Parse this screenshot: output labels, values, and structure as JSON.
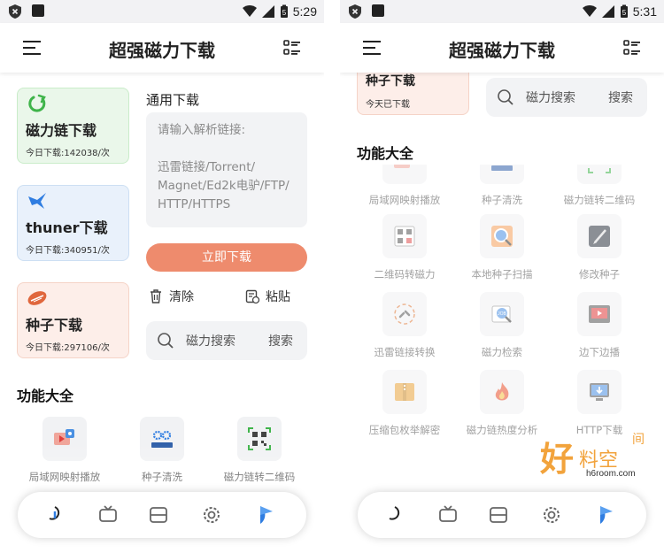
{
  "left": {
    "status": {
      "time": "5:29"
    },
    "appbar": {
      "title": "超强磁力下载"
    },
    "cards": [
      {
        "title": "磁力链下载",
        "sub": "今日下载:142038/次",
        "bg": "#eaf7ea",
        "border": "#c9ecc9"
      },
      {
        "title": "thuner下载",
        "sub": "今日下载:340951/次",
        "bg": "#e9f1fb",
        "border": "#cddff3"
      },
      {
        "title": "种子下载",
        "sub": "今日下载:297106/次",
        "bg": "#fdeee9",
        "border": "#f5d3c7"
      }
    ],
    "general": {
      "title": "通用下载",
      "placeholder_1": "请输入解析链接:",
      "placeholder_2": "迅雷链接/Torrent/",
      "placeholder_3": "Magnet/Ed2k电驴/FTP/",
      "placeholder_4": "HTTP/HTTPS",
      "download_button": "立即下载",
      "clear_label": "清除",
      "paste_label": "粘贴"
    },
    "search": {
      "placeholder": "磁力搜索",
      "button": "搜索"
    },
    "functions": {
      "title": "功能大全",
      "tools": [
        {
          "label": "局域网映射播放",
          "icon": "video-cast-icon"
        },
        {
          "label": "种子清洗",
          "icon": "gears-icon"
        },
        {
          "label": "磁力链转二维码",
          "icon": "qrcode-icon"
        }
      ]
    }
  },
  "right": {
    "status": {
      "time": "5:31"
    },
    "appbar": {
      "title": "超强磁力下载"
    },
    "partial_card": {
      "title": "种子下载",
      "sub": "今天已下载"
    },
    "search": {
      "placeholder": "磁力搜索",
      "button": "搜索"
    },
    "functions": {
      "title": "功能大全",
      "tools": [
        {
          "label": "局域网映射播放",
          "icon": "video-cast-icon"
        },
        {
          "label": "种子清洗",
          "icon": "gears-icon"
        },
        {
          "label": "磁力链转二维码",
          "icon": "qrcode-icon"
        },
        {
          "label": "二维码转磁力",
          "icon": "qrcode-scan-icon"
        },
        {
          "label": "本地种子扫描",
          "icon": "magnifier-icon"
        },
        {
          "label": "修改种子",
          "icon": "edit-icon"
        },
        {
          "label": "迅雷链接转换",
          "icon": "link-convert-icon"
        },
        {
          "label": "磁力检索",
          "icon": "search-job-icon"
        },
        {
          "label": "边下边播",
          "icon": "play-icon"
        },
        {
          "label": "压缩包枚举解密",
          "icon": "zip-folder-icon"
        },
        {
          "label": "磁力链热度分析",
          "icon": "fire-icon"
        },
        {
          "label": "HTTP下载",
          "icon": "http-download-icon"
        }
      ]
    }
  },
  "watermark": {
    "big": "好",
    "mid": "料空",
    "small": "间",
    "url": "h6room.com"
  },
  "colors": {
    "accent": "#ee8b6d",
    "highlight": "#6fe07a",
    "blue": "#2f7de1"
  }
}
